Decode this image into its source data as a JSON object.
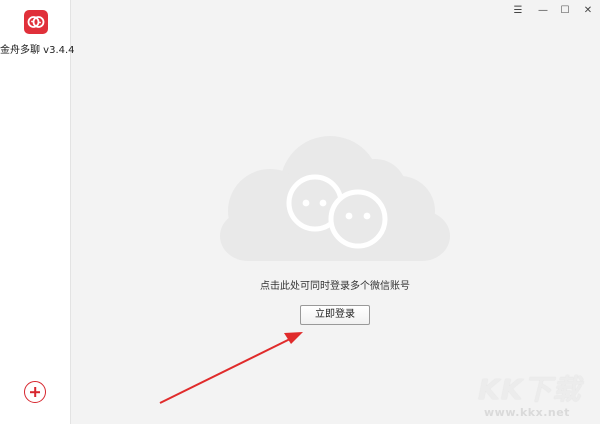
{
  "app": {
    "name": "金舟多聊 v3.4.4",
    "brand_color": "#e0303a"
  },
  "window_controls": {
    "menu_icon": "menu-icon",
    "minimize_icon": "minimize-icon",
    "maximize_icon": "maximize-icon",
    "close_icon": "close-icon",
    "menu_glyph": "☰",
    "minimize_glyph": "—",
    "maximize_glyph": "☐",
    "close_glyph": "✕"
  },
  "sidebar": {
    "add_icon": "plus-circle-icon",
    "accent": "#d7262e"
  },
  "main": {
    "illustration_icon": "cloud-chat-icon",
    "hint_text": "点击此处可同时登录多个微信账号",
    "login_button": "立即登录",
    "arrow_color": "#e02b2b"
  },
  "watermark": {
    "title": "KK下载",
    "url": "www.kkx.net"
  }
}
